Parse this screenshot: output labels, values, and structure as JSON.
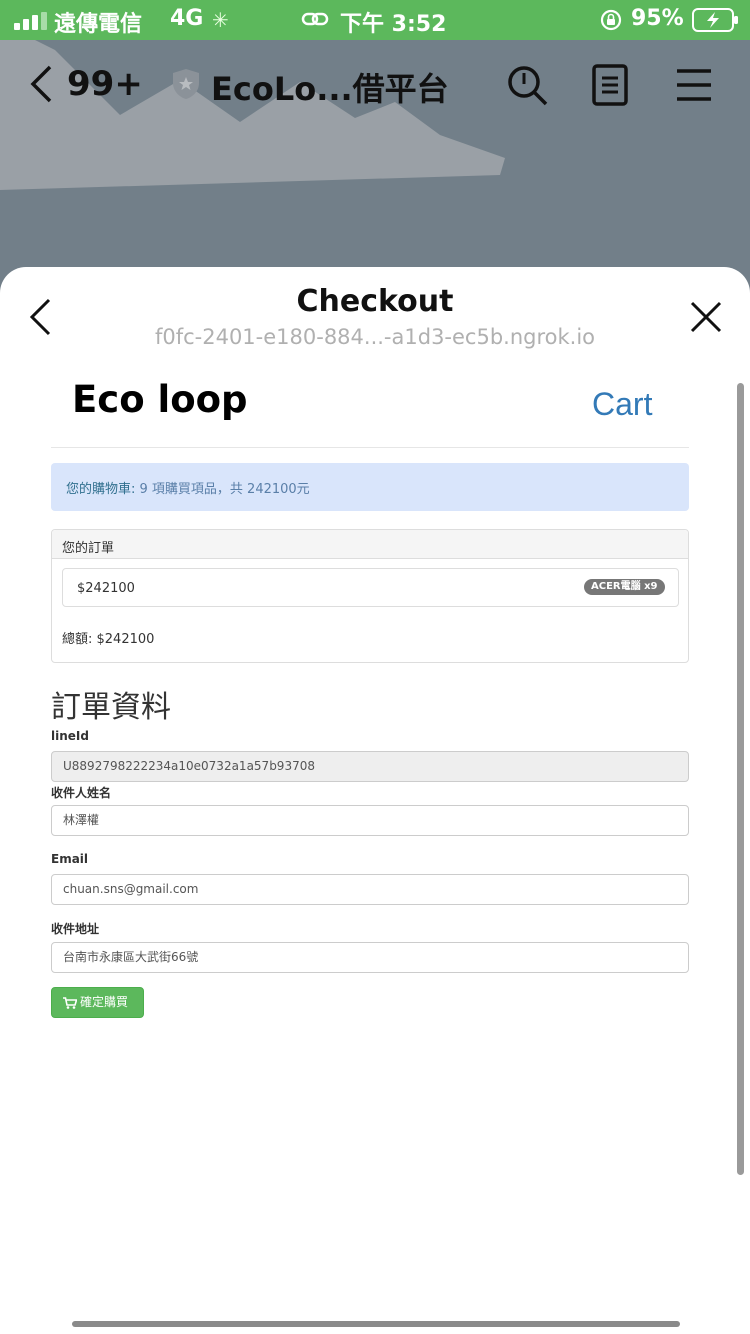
{
  "status_bar": {
    "carrier": "遠傳電信",
    "network": "4G",
    "time": "下午 3:52",
    "battery": "95%"
  },
  "chat_header": {
    "unread_count": "99+",
    "title": "EcoLo...借平台"
  },
  "sheet": {
    "title": "Checkout",
    "url": "f0fc-2401-e180-884...-a1d3-ec5b.ngrok.io"
  },
  "page": {
    "brand_text": "Eco loop",
    "cart_link": "Cart",
    "alert": {
      "prefix": "您的購物車: ",
      "summary": "9 項購買項品，共 242100元"
    },
    "order_panel": {
      "heading": "您的訂單",
      "items": [
        {
          "price": "$242100",
          "badge": "ACER電腦 x9"
        }
      ],
      "total": "總額: $242100"
    },
    "form": {
      "heading": "訂單資料",
      "lineid_label": "lineId",
      "lineid_value": "U8892798222234a10e0732a1a57b93708",
      "name_label": "收件人姓名",
      "name_value": "林澤權",
      "email_label": "Email",
      "email_value": "chuan.sns@gmail.com",
      "address_label": "收件地址",
      "address_value": "台南市永康區大武街66號",
      "submit_label": "確定購買"
    }
  },
  "colors": {
    "status_bar": "#5cb85c",
    "link_blue": "#337ab7",
    "alert_bg": "#d9e5fb",
    "button_green": "#5cb85c"
  }
}
